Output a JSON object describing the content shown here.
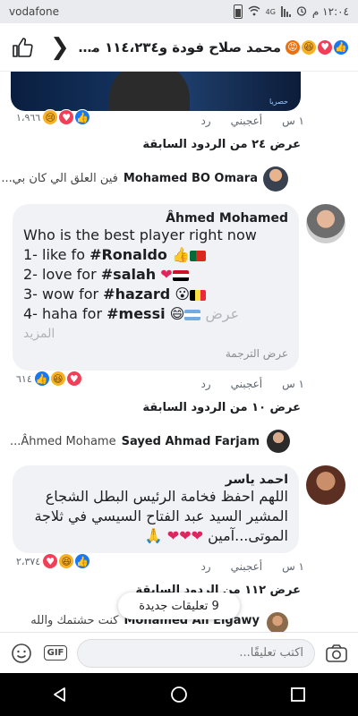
{
  "status": {
    "time": "١٢:٠٤ م",
    "carrier": "vodafone",
    "network": "4G"
  },
  "header": {
    "title": "محمد صلاح فودة و١١٤،٢٣٤ من الأ...",
    "reactions": [
      "like",
      "love",
      "haha",
      "angry"
    ]
  },
  "image": {
    "caption": "حصريا"
  },
  "post_footer": {
    "reaction_count": "١،٩٦٦",
    "reactions": [
      "like",
      "love",
      "sad"
    ],
    "time": "١ س",
    "like_label": "أعجبني",
    "reply_label": "رد",
    "previous_replies": "عرض ٢٤ من الردود السابقة"
  },
  "reply1": {
    "name": "Mohamed BO Omara",
    "text": "فين العلق الي كان بي..."
  },
  "comment1": {
    "author": "Âhmed Mohamed",
    "line1": "Who is the best player right  now",
    "line2_prefix": "1- like fo  ",
    "line2_tag": "#Ronaldo",
    "line3_prefix": "2- love for     ",
    "line3_tag": "#salah",
    "line4_prefix": "3- wow for  ",
    "line4_tag": "#hazard",
    "line5_prefix": "4- haha for    ",
    "line5_tag": "#messi",
    "see_more_1": "عرض",
    "see_more_2": "المزيد",
    "see_translation": "عرض الترجمة",
    "reaction_count": "٦١٤",
    "reactions": [
      "like",
      "haha",
      "love"
    ],
    "time": "١ س",
    "like_label": "أعجبني",
    "reply_label": "رد",
    "previous_replies": "عرض ١٠ من الردود السابقة"
  },
  "reply2": {
    "name": "Sayed Ahmad Farjam",
    "text": "Âhmed Mohame..."
  },
  "comment2": {
    "author": "احمد ياسر",
    "line1": "اللهم احفظ فخامة الرئيس البطل الشجاع",
    "line2": "المشير السيد عبد الفتاح السيسي في ثلاجة",
    "line3": "الموتى...آمين",
    "reaction_count": "٢،٣٧٤",
    "reactions": [
      "like",
      "haha",
      "love"
    ],
    "time": "١ س",
    "like_label": "أعجبني",
    "reply_label": "رد",
    "previous_replies": "عرض ١١٢ من الردود السابقة"
  },
  "reply3": {
    "name": "Mohamed Ali Elgawy",
    "text": "كنت حشتمك والله"
  },
  "new_comments_pill": "9 تعليقات جديدة",
  "composer": {
    "placeholder": "اكتب تعليقًا...",
    "gif_label": "GIF"
  },
  "icons": {
    "header": [
      "like-thumb-icon",
      "back-chevron-icon"
    ],
    "composer": [
      "emoji-icon",
      "gif-icon",
      "camera-icon"
    ],
    "nav": [
      "back-triangle-icon",
      "home-circle-icon",
      "recents-square-icon"
    ]
  }
}
